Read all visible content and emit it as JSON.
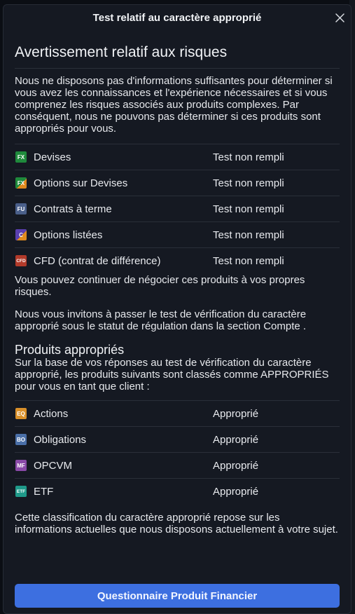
{
  "modal": {
    "title": "Test relatif au caractère approprié"
  },
  "risk": {
    "heading": "Avertissement relatif aux risques",
    "intro": "Nous ne disposons pas d'informations suffisantes pour déterminer si vous avez les connaissances et l'expérience nécessaires et si vous comprenez les risques associés aux produits complexes. Par conséquent, nous ne pouvons pas déterminer si ces produits sont appropriés pour vous.",
    "products": [
      {
        "badge": "FX",
        "badge_color": "#1f8a3c",
        "icon": "fx-icon",
        "name": "Devises",
        "status": "Test non rempli"
      },
      {
        "badge": "FX",
        "badge_color": "#1f8a3c",
        "icon": "fx-options-icon",
        "name": "Options sur Devises",
        "status": "Test non rempli"
      },
      {
        "badge": "FU",
        "badge_color": "#4a5f8a",
        "icon": "futures-icon",
        "name": "Contrats à terme",
        "status": "Test non rempli"
      },
      {
        "badge": "C",
        "badge_color": "#5a3fb0",
        "icon": "listed-options-icon",
        "name": "Options listées",
        "status": "Test non rempli"
      },
      {
        "badge": "CFD",
        "badge_color": "#b23a2a",
        "icon": "cfd-icon",
        "name": "CFD (contrat de différence)",
        "status": "Test non rempli"
      }
    ],
    "continue_text": "Vous pouvez continuer de négocier ces produits à vos propres risques.",
    "invite_text": "Nous vous invitons à passer le  test de vérification du caractère approprié  sous le statut de régulation dans la section  Compte ."
  },
  "appropriate": {
    "heading": "Produits appropriés",
    "basis_text": "Sur la base de vos réponses au test de vérification du caractère approprié, les produits suivants sont classés comme APPROPRIÉS pour vous en tant que client :",
    "products": [
      {
        "badge": "EQ",
        "badge_color": "#d9902a",
        "icon": "equities-icon",
        "name": "Actions",
        "status": "Approprié"
      },
      {
        "badge": "BO",
        "badge_color": "#4a6fa8",
        "icon": "bonds-icon",
        "name": "Obligations",
        "status": "Approprié"
      },
      {
        "badge": "MF",
        "badge_color": "#8a4aa8",
        "icon": "funds-icon",
        "name": "OPCVM",
        "status": "Approprié"
      },
      {
        "badge": "ETF",
        "badge_color": "#1f9a8a",
        "icon": "etf-icon",
        "name": "ETF",
        "status": "Approprié"
      }
    ],
    "classification_text": "Cette classification du caractère approprié repose sur les informations actuelles que nous disposons actuellement à votre sujet."
  },
  "cta": {
    "label": "Questionnaire Produit Financier",
    "color": "#3d6fe0"
  }
}
